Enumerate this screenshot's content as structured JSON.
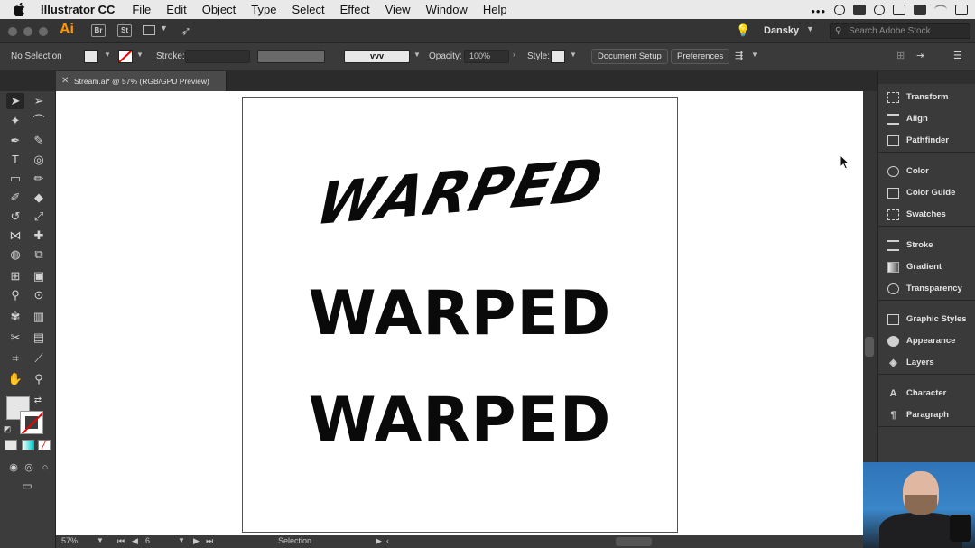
{
  "menubar": {
    "app_name": "Illustrator CC",
    "items": [
      "File",
      "Edit",
      "Object",
      "Type",
      "Select",
      "Effect",
      "View",
      "Window",
      "Help"
    ],
    "tray_dots": "•••"
  },
  "appbar": {
    "logo": "Ai",
    "bridge": "Br",
    "stock": "St",
    "workspace": "Dansky",
    "search_placeholder": "Search Adobe Stock"
  },
  "controlbar": {
    "selection": "No Selection",
    "stroke_label": "Stroke:",
    "brush": "vvv",
    "opacity_label": "Opacity:",
    "opacity_value": "100%",
    "style_label": "Style:",
    "document_setup": "Document Setup",
    "preferences": "Preferences"
  },
  "tab": {
    "title": "Stream.ai* @ 57% (RGB/GPU Preview)"
  },
  "artboard": {
    "text_1": "WARPED",
    "text_2": "WARPED",
    "text_3": "WARPED"
  },
  "statusbar": {
    "zoom": "57%",
    "artboard_number": "6",
    "tool": "Selection"
  },
  "panels": {
    "group1": [
      "Transform",
      "Align",
      "Pathfinder"
    ],
    "group2": [
      "Color",
      "Color Guide",
      "Swatches"
    ],
    "group3": [
      "Stroke",
      "Gradient",
      "Transparency"
    ],
    "group4": [
      "Graphic Styles",
      "Appearance",
      "Layers"
    ],
    "group5": [
      "Character",
      "Paragraph"
    ]
  },
  "colors": {
    "accent_ai": "#ff9a00",
    "canvas": "#ffffff",
    "chrome_dark": "#3a3a3a"
  }
}
